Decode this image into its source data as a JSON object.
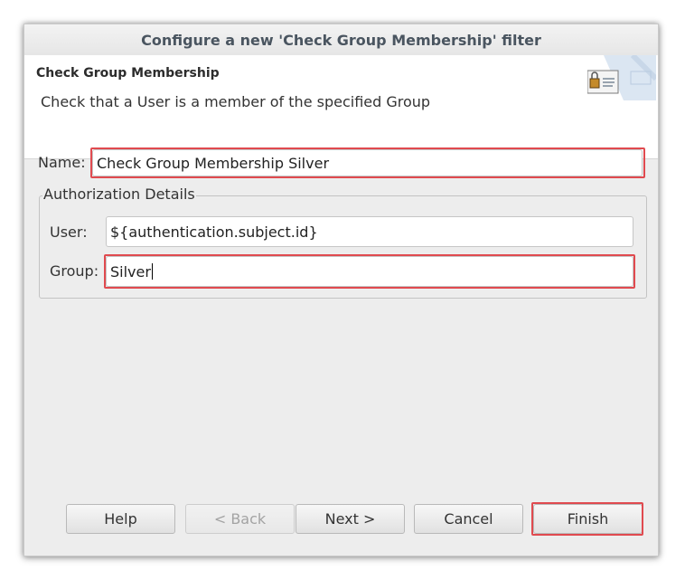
{
  "window": {
    "title": "Configure a new 'Check Group Membership' filter"
  },
  "banner": {
    "title": "Check Group Membership",
    "description": "Check that a User is a member of the specified Group",
    "icon": "user-card-icon"
  },
  "form": {
    "name_label": "Name:",
    "name_value": "Check Group Membership Silver",
    "group_box_title": "Authorization Details",
    "user_label": "User:",
    "user_value": "${authentication.subject.id}",
    "group_label": "Group:",
    "group_value": "Silver"
  },
  "buttons": {
    "help": "Help",
    "back": "< Back",
    "next": "Next >",
    "cancel": "Cancel",
    "finish": "Finish"
  },
  "colors": {
    "highlight": "#e04a4f",
    "dialog_bg": "#ededed",
    "title_text": "#4a5560"
  }
}
